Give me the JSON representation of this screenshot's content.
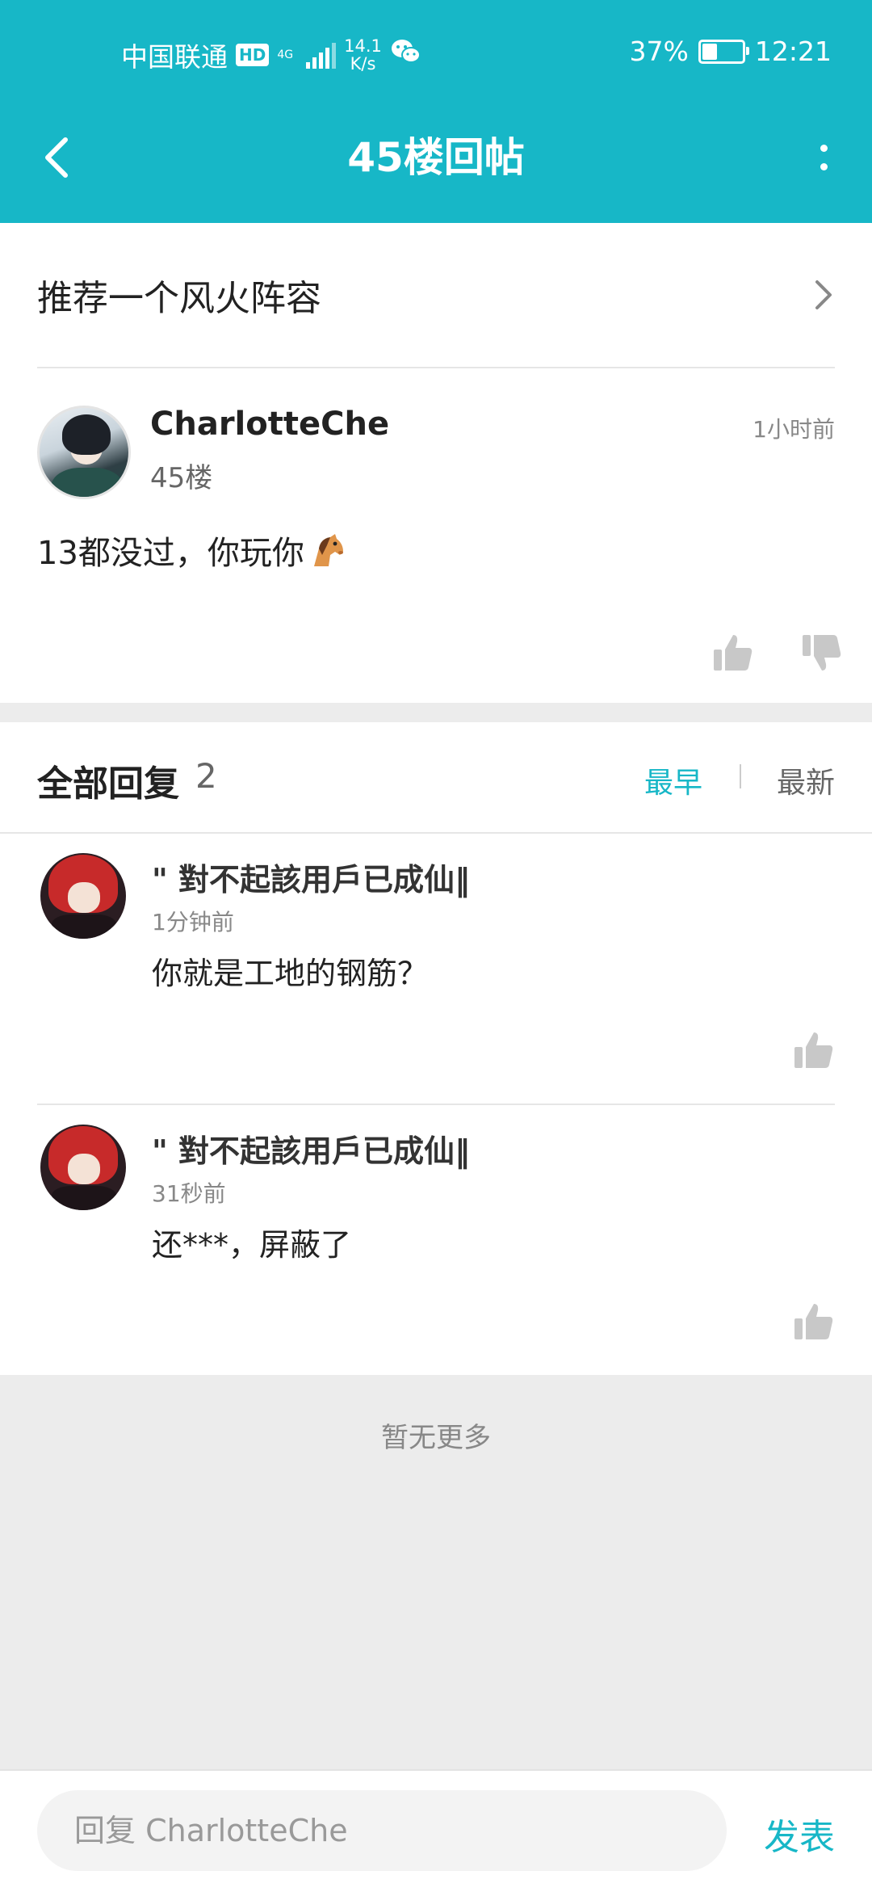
{
  "status_bar": {
    "carrier": "中国联通",
    "hd_badge": "HD",
    "network_type": "4G",
    "speed_value": "14.1",
    "speed_unit": "K/s",
    "battery_percent": "37%",
    "battery_level": 0.37,
    "time": "12:21"
  },
  "navbar": {
    "title": "45楼回帖"
  },
  "topic": {
    "title": "推荐一个风火阵容"
  },
  "post": {
    "author": "CharlotteChe",
    "floor": "45楼",
    "time": "1小时前",
    "content": "13都没过，你玩你"
  },
  "replies_section": {
    "title": "全部回复",
    "count": "2",
    "sort_earliest": "最早",
    "sort_latest": "最新"
  },
  "replies": [
    {
      "author": "\" 對不起該用戶已成仙‖",
      "time": "1分钟前",
      "content": "你就是工地的钢筋？"
    },
    {
      "author": "\" 對不起該用戶已成仙‖",
      "time": "31秒前",
      "content": "还***，屏蔽了"
    }
  ],
  "no_more_text": "暂无更多",
  "bottom_bar": {
    "input_placeholder": "回复 CharlotteChe",
    "send_label": "发表"
  },
  "colors": {
    "accent": "#17b7c7",
    "background": "#ececec"
  }
}
